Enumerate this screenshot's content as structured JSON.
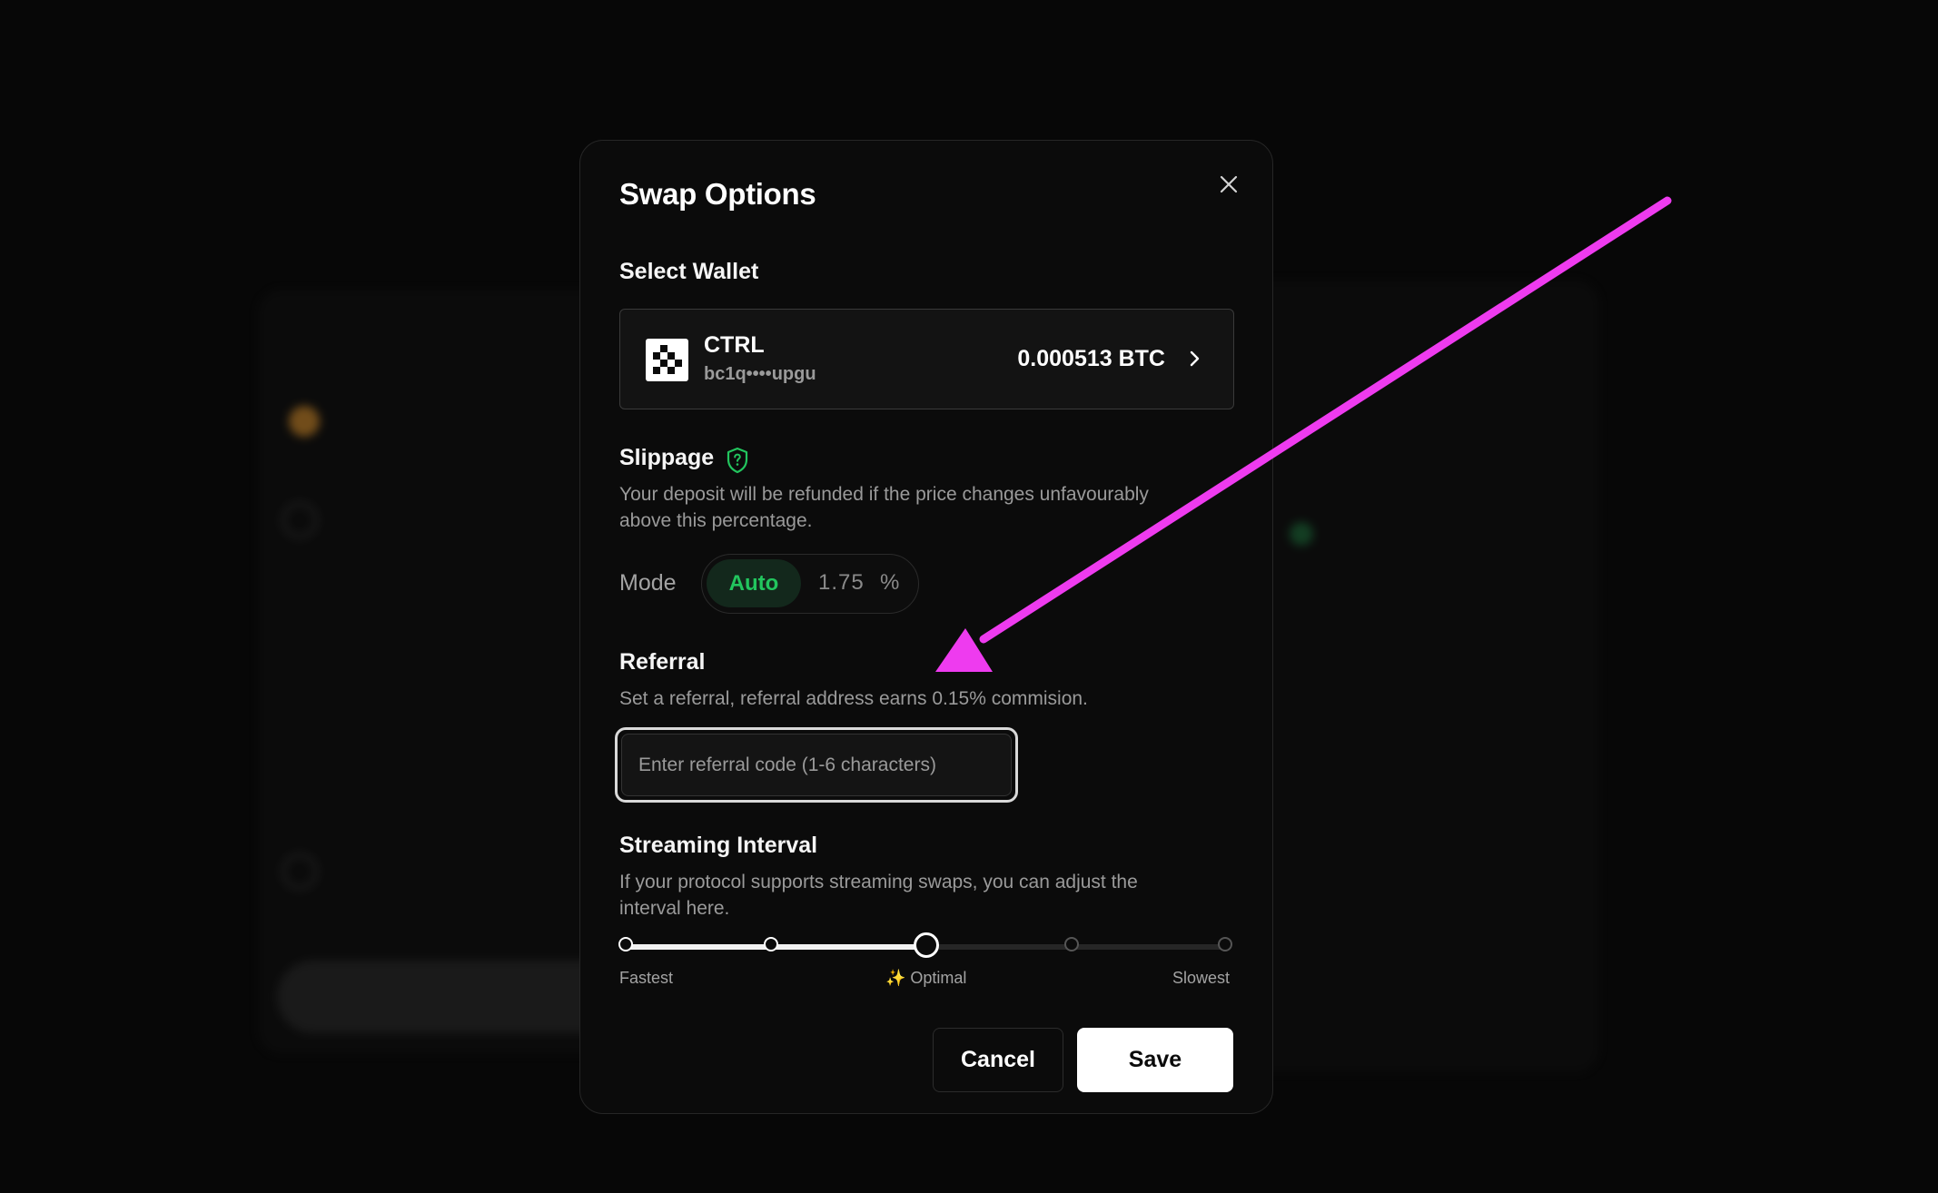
{
  "modal": {
    "title": "Swap Options",
    "close_icon": "close-icon"
  },
  "wallet_section": {
    "label": "Select Wallet",
    "wallet": {
      "name": "CTRL",
      "address": "bc1q••••upgu",
      "balance": "0.000513 BTC",
      "logo_icon": "ctrl-logo-icon",
      "chevron_icon": "chevron-right-icon"
    }
  },
  "slippage": {
    "label": "Slippage",
    "info_icon": "shield-question-icon",
    "description_line1": "Your deposit will be refunded if the price changes unfavourably",
    "description_line2": "above this percentage.",
    "mode_label": "Mode",
    "auto_label": "Auto",
    "value": "1.75",
    "unit": "%"
  },
  "referral": {
    "label": "Referral",
    "description": "Set a referral, referral address earns 0.15% commision.",
    "placeholder": "Enter referral code (1-6 characters)",
    "value": ""
  },
  "streaming": {
    "label": "Streaming Interval",
    "description_line1": "If your protocol supports streaming swaps, you can adjust the",
    "description_line2": "interval here.",
    "slider_level": 0.5,
    "labels": {
      "fastest": "Fastest",
      "optimal": "✨ Optimal",
      "slowest": "Slowest"
    }
  },
  "actions": {
    "cancel_label": "Cancel",
    "save_label": "Save"
  },
  "colors": {
    "accent_green": "#22c55e",
    "annotation_arrow": "#ee3bef",
    "modal_bg": "#0b0b0b"
  }
}
